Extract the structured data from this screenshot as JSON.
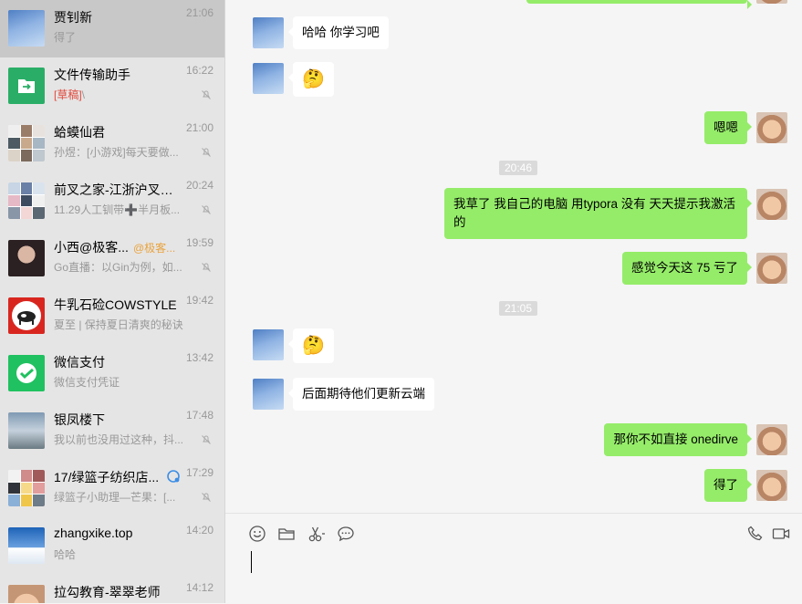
{
  "conversations": [
    {
      "name": "贾钊新",
      "time": "21:06",
      "preview": "得了",
      "muted": false
    },
    {
      "name": "文件传输助手",
      "time": "16:22",
      "draft": "[草稿]",
      "preview": "\\",
      "muted": true
    },
    {
      "name": "蛤蟆仙君",
      "time": "21:00",
      "preview": "孙煜：[小游戏]每天要做...",
      "muted": true
    },
    {
      "name": "前叉之家-江浙沪叉友...",
      "time": "20:24",
      "preview": "11.29人工钏带➕半月板...",
      "muted": true
    },
    {
      "name": "小西@极客...",
      "mention": "@极客...",
      "time": "19:59",
      "preview": "Go直播：以Gin为例，如...",
      "muted": true
    },
    {
      "name": "牛乳石硷COWSTYLE",
      "time": "19:42",
      "preview": "夏至 | 保持夏日清爽的秘诀",
      "muted": false
    },
    {
      "name": "微信支付",
      "time": "13:42",
      "preview": "微信支付凭证",
      "muted": false
    },
    {
      "name": "银凤楼下",
      "time": "17:48",
      "preview": "我以前也没用过这种，抖...",
      "muted": true
    },
    {
      "name": "17/绿篮子纺织店...",
      "time": "17:29",
      "preview": "绿篮子小助理—芒果：[...",
      "muted": true
    },
    {
      "name": "zhangxike.top",
      "time": "14:20",
      "preview": "哈哈",
      "muted": false
    },
    {
      "name": "拉勾教育-翠翠老师",
      "time": "14:12",
      "preview": "",
      "muted": false
    }
  ],
  "messages": [
    {
      "side": "left",
      "text": "哈哈 你学习吧"
    },
    {
      "side": "left",
      "text": "🤔"
    },
    {
      "side": "right",
      "text": "嗯嗯"
    },
    {
      "type": "time",
      "text": "20:46"
    },
    {
      "side": "right",
      "text": "我草了 我自己的电脑 用typora 没有 天天提示我激活的"
    },
    {
      "side": "right",
      "text": "感觉今天这 75 亏了"
    },
    {
      "type": "time",
      "text": "21:05"
    },
    {
      "side": "left",
      "text": "🤔"
    },
    {
      "side": "left",
      "text": "后面期待他们更新云端"
    },
    {
      "side": "right",
      "text": "那你不如直接 onedirve"
    },
    {
      "side": "right",
      "text": "得了"
    }
  ],
  "composer": {
    "tools": [
      "emoji-icon",
      "folder-icon",
      "scissors-icon",
      "chat-history-icon"
    ],
    "call_tools": [
      "phone-icon",
      "video-icon"
    ]
  },
  "colors": {
    "sent_bubble": "#95ec69",
    "received_bubble": "#ffffff",
    "sidebar": "#e6e5e5",
    "selected": "#c9c8c8"
  }
}
